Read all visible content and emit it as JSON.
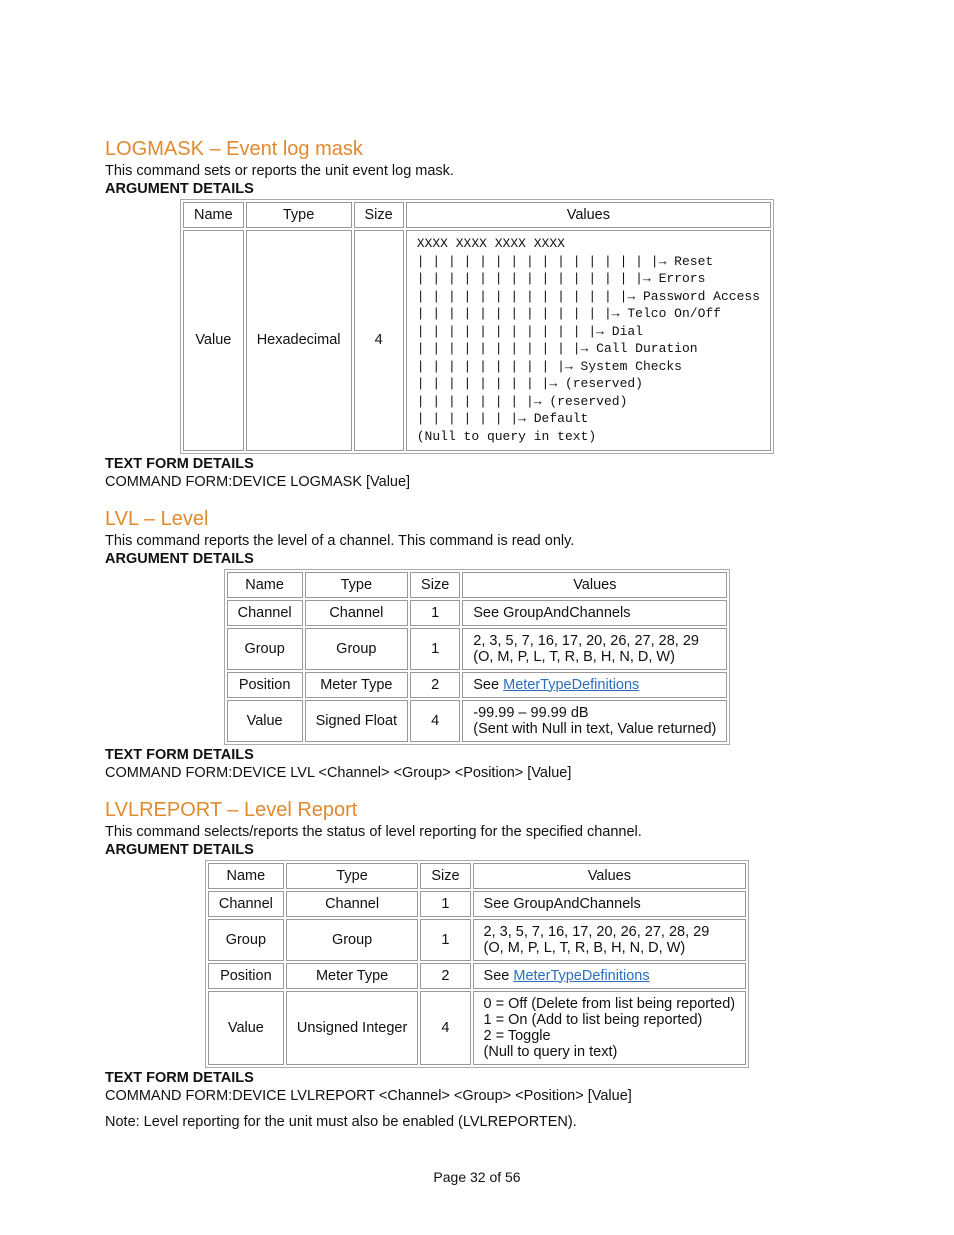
{
  "footer": "Page 32 of 56",
  "labels": {
    "arg_details": "ARGUMENT DETAILS",
    "text_form_details": "TEXT FORM DETAILS",
    "cmd_form_prefix": "COMMAND FORM:",
    "th_name": "Name",
    "th_type": "Type",
    "th_size": "Size",
    "th_values": "Values"
  },
  "sections": [
    {
      "title": "LOGMASK – Event log mask",
      "desc": "This command sets or reports the unit event log mask.",
      "command_form": "DEVICE LOGMASK [Value]",
      "notes": [],
      "rows": [
        {
          "name": "Value",
          "type": "Hexadecimal",
          "size": "4",
          "mono": true,
          "values": "XXXX XXXX XXXX XXXX\n| | | | | | | | | | | | | | | |→ Reset\n| | | | | | | | | | | | | | |→ Errors\n| | | | | | | | | | | | | |→ Password Access\n| | | | | | | | | | | | |→ Telco On/Off\n| | | | | | | | | | | |→ Dial\n| | | | | | | | | | |→ Call Duration\n| | | | | | | | | |→ System Checks\n| | | | | | | | |→ (reserved)\n| | | | | | | |→ (reserved)\n| | | | | | |→ Default\n(Null to query in text)"
        }
      ]
    },
    {
      "title": "LVL – Level",
      "desc": "This command reports the level of a channel.  This command is read only.",
      "command_form": "DEVICE LVL <Channel> <Group> <Position> [Value]",
      "notes": [],
      "rows": [
        {
          "name": "Channel",
          "type": "Channel",
          "size": "1",
          "values": "See GroupAndChannels"
        },
        {
          "name": "Group",
          "type": "Group",
          "size": "1",
          "values": "2, 3, 5, 7, 16, 17, 20, 26, 27, 28, 29\n(O, M, P, L, T, R, B, H, N, D, W)"
        },
        {
          "name": "Position",
          "type": "Meter Type",
          "size": "2",
          "values_prefix": "See ",
          "values_link": "MeterTypeDefinitions"
        },
        {
          "name": "Value",
          "type": "Signed Float",
          "size": "4",
          "values": "-99.99 – 99.99 dB\n(Sent with Null in text, Value returned)"
        }
      ]
    },
    {
      "title": "LVLREPORT – Level Report",
      "desc": "This command selects/reports the status of level reporting for the specified channel.",
      "command_form": "DEVICE LVLREPORT <Channel> <Group> <Position> [Value]",
      "notes": [
        "Note: Level reporting for the unit must also be enabled (LVLREPORTEN)."
      ],
      "rows": [
        {
          "name": "Channel",
          "type": "Channel",
          "size": "1",
          "values": "See GroupAndChannels"
        },
        {
          "name": "Group",
          "type": "Group",
          "size": "1",
          "values": "2, 3, 5, 7, 16, 17, 20, 26, 27, 28, 29\n(O, M, P, L, T, R, B, H, N, D, W)"
        },
        {
          "name": "Position",
          "type": "Meter Type",
          "size": "2",
          "values_prefix": "See ",
          "values_link": "MeterTypeDefinitions"
        },
        {
          "name": "Value",
          "type": "Unsigned Integer",
          "size": "4",
          "values": "0 = Off (Delete from list being reported)\n1 = On (Add to list being reported)\n2 = Toggle\n(Null to query in text)"
        }
      ]
    }
  ]
}
